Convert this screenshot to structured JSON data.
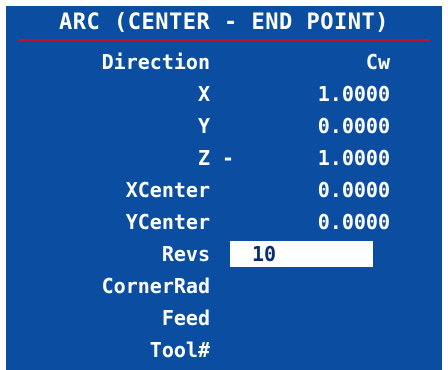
{
  "dialog": {
    "title": "ARC (CENTER - END POINT)"
  },
  "fields": {
    "direction": {
      "label": "Direction",
      "value": "Cw"
    },
    "x": {
      "label": "X",
      "value": "1.0000"
    },
    "y": {
      "label": "Y",
      "value": "0.0000"
    },
    "z": {
      "label": "Z",
      "sign": "-",
      "value": "1.0000"
    },
    "xcenter": {
      "label": "XCenter",
      "value": "0.0000"
    },
    "ycenter": {
      "label": "YCenter",
      "value": "0.0000"
    },
    "revs": {
      "label": "Revs",
      "value": "10"
    },
    "cornerrad": {
      "label": "CornerRad",
      "value": ""
    },
    "feed": {
      "label": "Feed",
      "value": ""
    },
    "tool": {
      "label": "Tool#",
      "value": ""
    }
  },
  "colors": {
    "panel_background": "#0b4ea1",
    "text": "#ffffff",
    "title_underline": "#c8102e",
    "input_background": "#ffffff",
    "input_text": "#0b2f6e"
  }
}
